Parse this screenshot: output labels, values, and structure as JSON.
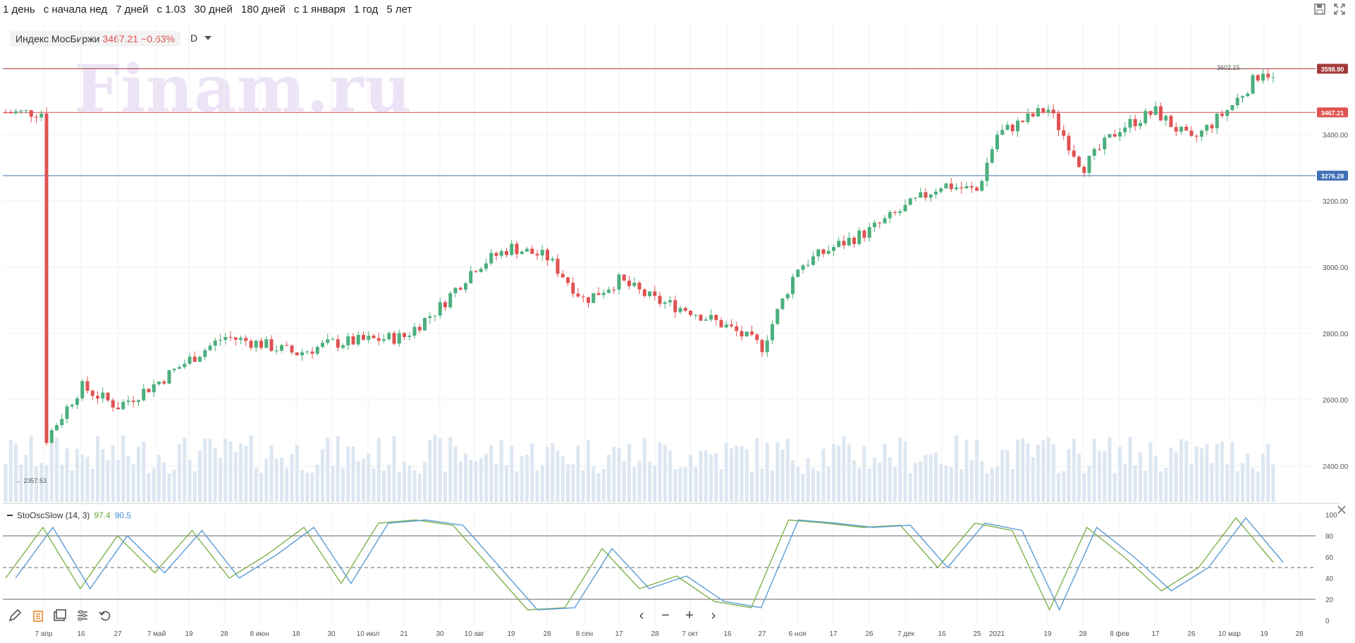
{
  "periods": [
    "1 день",
    "с начала нед",
    "7 дней",
    "с 1.03",
    "30 дней",
    "180 дней",
    "с 1 января",
    "1 год",
    "5 лет"
  ],
  "ticker": {
    "name": "Индекс МосБиржи",
    "value": "3467.21",
    "change": "−0.63%",
    "timeframe": "D"
  },
  "watermark": "Finam.ru",
  "price_axis": {
    "labels": [
      "3400.00",
      "3200.00",
      "3000.00",
      "2800.00",
      "2600.00",
      "2400.00"
    ]
  },
  "level_lines": [
    {
      "label": "3598.90",
      "color": "#a33a3a"
    },
    {
      "label": "3467.21",
      "color": "#e05252"
    },
    {
      "label": "3276.28",
      "color": "#3f6fb5"
    }
  ],
  "annotations": {
    "high": "3602.15",
    "low": "2357.53"
  },
  "oscillator": {
    "name": "StoOscSlow (14, 3)",
    "k_value": "97.4",
    "d_value": "90.5",
    "axis": [
      "100",
      "80",
      "60",
      "40",
      "20",
      "0"
    ]
  },
  "time_axis": [
    "7 апр",
    "16",
    "27",
    "7 май",
    "19",
    "28",
    "8 июн",
    "18",
    "30",
    "10 июл",
    "21",
    "30",
    "10 авг",
    "19",
    "28",
    "8 сен",
    "17",
    "28",
    "7 окт",
    "16",
    "27",
    "6 ноя",
    "17",
    "26",
    "7 дек",
    "16",
    "25",
    "2021",
    "19",
    "28",
    "8 фев",
    "17",
    "26",
    "10 мар",
    "19",
    "28"
  ],
  "colors": {
    "up": "#4caf7d",
    "down": "#e05252",
    "volume": "#dde7f2",
    "k_line": "#7fb24a",
    "d_line": "#5a9bd5"
  },
  "chart_data": {
    "type": "candlestick",
    "title": "Индекс МосБиржи",
    "price_range": [
      2300,
      3650
    ],
    "price_anchors": [
      [
        "7 апр",
        2470
      ],
      [
        "16",
        2640
      ],
      [
        "27",
        2580
      ],
      [
        "7 май",
        2650
      ],
      [
        "19",
        2720
      ],
      [
        "28",
        2790
      ],
      [
        "8 июн",
        2770
      ],
      [
        "18",
        2740
      ],
      [
        "30",
        2770
      ],
      [
        "10 июл",
        2780
      ],
      [
        "21",
        2790
      ],
      [
        "30",
        2880
      ],
      [
        "10 авг",
        3000
      ],
      [
        "19",
        3060
      ],
      [
        "28",
        3030
      ],
      [
        "8 сен",
        2900
      ],
      [
        "17",
        2960
      ],
      [
        "28",
        2900
      ],
      [
        "7 окт",
        2870
      ],
      [
        "16",
        2820
      ],
      [
        "27",
        2760
      ],
      [
        "6 ноя",
        3000
      ],
      [
        "17",
        3060
      ],
      [
        "26",
        3110
      ],
      [
        "7 дек",
        3180
      ],
      [
        "16",
        3250
      ],
      [
        "25",
        3230
      ],
      [
        "2021",
        3400
      ],
      [
        "19",
        3480
      ],
      [
        "28",
        3300
      ],
      [
        "8 фев",
        3420
      ],
      [
        "17",
        3470
      ],
      [
        "26",
        3380
      ],
      [
        "10 мар",
        3480
      ],
      [
        "19",
        3600
      ],
      [
        "end",
        3467
      ]
    ],
    "oscillator_k": [
      40,
      88,
      30,
      80,
      45,
      85,
      40,
      62,
      88,
      35,
      92,
      95,
      90,
      50,
      10,
      12,
      68,
      30,
      42,
      18,
      12,
      95,
      92,
      88,
      90,
      50,
      92,
      85,
      10,
      88,
      60,
      28,
      50,
      97,
      55
    ]
  }
}
